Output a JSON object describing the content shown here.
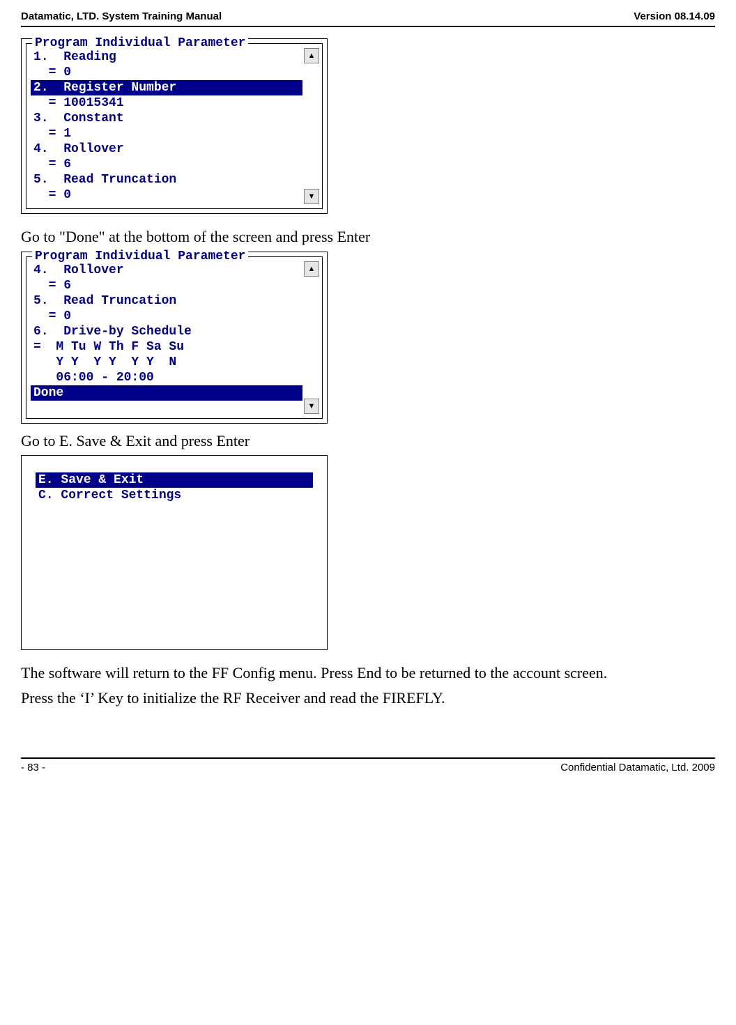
{
  "header": {
    "left": "Datamatic, LTD. System Training  Manual",
    "right": "Version 08.14.09"
  },
  "screenshot1": {
    "legend": "Program Individual Parameter",
    "rows": [
      {
        "text": "1.  Reading",
        "selected": false
      },
      {
        "text": "  = 0",
        "selected": false
      },
      {
        "text": "2.  Register Number",
        "selected": true
      },
      {
        "text": "  = 10015341",
        "selected": false
      },
      {
        "text": "3.  Constant",
        "selected": false
      },
      {
        "text": "  = 1",
        "selected": false
      },
      {
        "text": "4.  Rollover",
        "selected": false
      },
      {
        "text": "  = 6",
        "selected": false
      },
      {
        "text": "5.  Read Truncation",
        "selected": false
      },
      {
        "text": "  = 0",
        "selected": false
      }
    ]
  },
  "para1": "Go to \"Done\" at the bottom of the screen and press Enter",
  "screenshot2": {
    "legend": "Program Individual Parameter",
    "rows": [
      {
        "text": "4.  Rollover",
        "selected": false
      },
      {
        "text": "  = 6",
        "selected": false
      },
      {
        "text": "5.  Read Truncation",
        "selected": false
      },
      {
        "text": "  = 0",
        "selected": false
      },
      {
        "text": "6.  Drive-by Schedule",
        "selected": false
      },
      {
        "text": "=  M Tu W Th F Sa Su",
        "selected": false
      },
      {
        "text": "   Y Y  Y Y  Y Y  N",
        "selected": false
      },
      {
        "text": "   06:00 - 20:00",
        "selected": false
      },
      {
        "text": "Done",
        "selected": true
      }
    ]
  },
  "para2": "Go to E. Save & Exit and press Enter",
  "screenshot3": {
    "rows": [
      {
        "text": "E. Save & Exit",
        "selected": true
      },
      {
        "text": "C. Correct Settings",
        "selected": false
      }
    ]
  },
  "para3": "The software will return to the FF Config menu. Press End to be returned to the account screen.",
  "para4": "Press the ‘I’ Key to initialize the RF Receiver and read the FIREFLY.",
  "footer": {
    "left": "- 83 -",
    "right": "Confidential Datamatic, Ltd. 2009"
  },
  "scroll": {
    "up": "▲",
    "down": "▼"
  }
}
